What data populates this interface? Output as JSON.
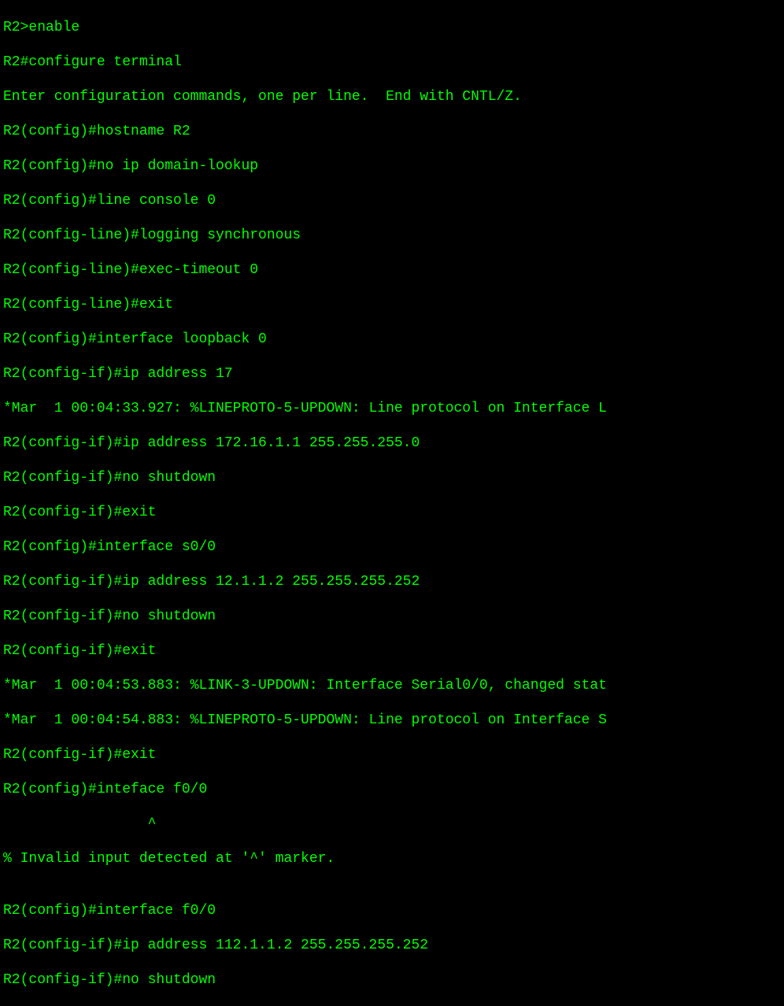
{
  "terminal": {
    "lines": [
      "R2>enable",
      "R2#configure terminal",
      "Enter configuration commands, one per line.  End with CNTL/Z.",
      "R2(config)#hostname R2",
      "R2(config)#no ip domain-lookup",
      "R2(config)#line console 0",
      "R2(config-line)#logging synchronous",
      "R2(config-line)#exec-timeout 0",
      "R2(config-line)#exit",
      "R2(config)#interface loopback 0",
      "R2(config-if)#ip address 17",
      "*Mar  1 00:04:33.927: %LINEPROTO-5-UPDOWN: Line protocol on Interface L",
      "R2(config-if)#ip address 172.16.1.1 255.255.255.0",
      "R2(config-if)#no shutdown",
      "R2(config-if)#exit",
      "R2(config)#interface s0/0",
      "R2(config-if)#ip address 12.1.1.2 255.255.255.252",
      "R2(config-if)#no shutdown",
      "R2(config-if)#exit",
      "*Mar  1 00:04:53.883: %LINK-3-UPDOWN: Interface Serial0/0, changed stat",
      "*Mar  1 00:04:54.883: %LINEPROTO-5-UPDOWN: Line protocol on Interface S",
      "R2(config-if)#exit",
      "R2(config)#inteface f0/0",
      "                 ^",
      "% Invalid input detected at '^' marker.",
      "",
      "R2(config)#interface f0/0",
      "R2(config-if)#ip address 112.1.1.2 255.255.255.252",
      "R2(config-if)#no shutdown"
    ]
  }
}
